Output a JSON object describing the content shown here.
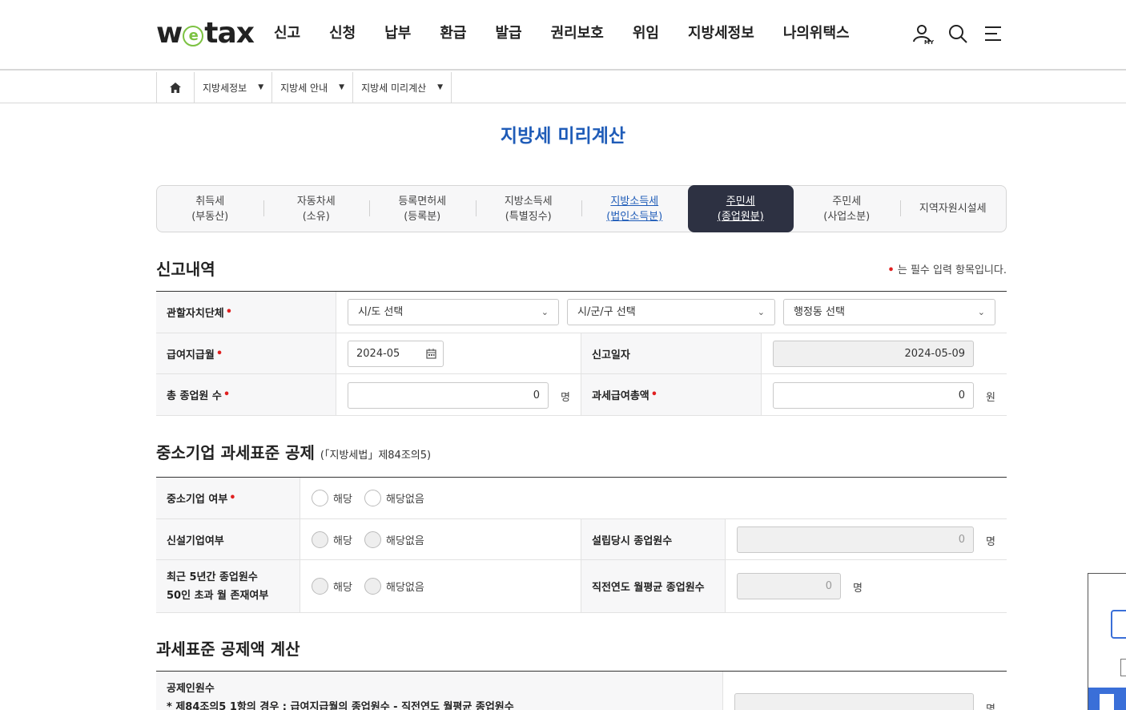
{
  "header": {
    "logo": "wetax",
    "nav": [
      "신고",
      "신청",
      "납부",
      "환급",
      "발급",
      "권리보호",
      "위임",
      "지방세정보",
      "나의위택스"
    ],
    "icons": [
      "my-page-icon",
      "search-icon",
      "menu-icon"
    ]
  },
  "breadcrumb": {
    "items": [
      "지방세정보",
      "지방세 안내",
      "지방세 미리계산"
    ]
  },
  "page_title": "지방세 미리계산",
  "tabs": [
    {
      "label": "취득세\n(부동산)",
      "state": "normal"
    },
    {
      "label": "자동차세\n(소유)",
      "state": "normal"
    },
    {
      "label": "등록면허세\n(등록분)",
      "state": "normal"
    },
    {
      "label": "지방소득세\n(특별징수)",
      "state": "normal"
    },
    {
      "label": "지방소득세\n(법인소득분)",
      "state": "link"
    },
    {
      "label": "주민세\n(종업원분)",
      "state": "active"
    },
    {
      "label": "주민세\n(사업소분)",
      "state": "normal"
    },
    {
      "label": "지역자원시설세",
      "state": "normal"
    }
  ],
  "report": {
    "title": "신고내역",
    "required_note": "는 필수 입력 항목입니다.",
    "jurisdiction_label": "관할자치단체",
    "sido_placeholder": "시/도 선택",
    "sigungu_placeholder": "시/군/구 선택",
    "dong_placeholder": "행정동 선택",
    "pay_month_label": "급여지급월",
    "pay_month_value": "2024-05",
    "report_date_label": "신고일자",
    "report_date_value": "2024-05-09",
    "employees_label": "총 종업원 수",
    "employees_value": "0",
    "employees_unit": "명",
    "salary_label": "과세급여총액",
    "salary_value": "0",
    "salary_unit": "원"
  },
  "sme": {
    "title": "중소기업 과세표준 공제",
    "law_ref": "(「지방세법」제84조의5)",
    "sme_label": "중소기업 여부",
    "new_label": "신설기업여부",
    "founding_label": "설립당시 종업원수",
    "founding_value": "0",
    "unit": "명",
    "over50_label_1": "최근 5년간 종업원수",
    "over50_label_2": "50인 초과 월 존재여부",
    "prev_avg_label": "직전연도 월평균 종업원수",
    "prev_avg_value": "0",
    "opt_yes": "해당",
    "opt_no": "해당없음"
  },
  "deduction": {
    "title": "과세표준 공제액 계산",
    "label": "공제인원수",
    "desc": "* 제84조의5 1항의 경우 : 급여지급월의 종업원수 - 직전연도 월평균 종업원수",
    "unit": "명"
  }
}
